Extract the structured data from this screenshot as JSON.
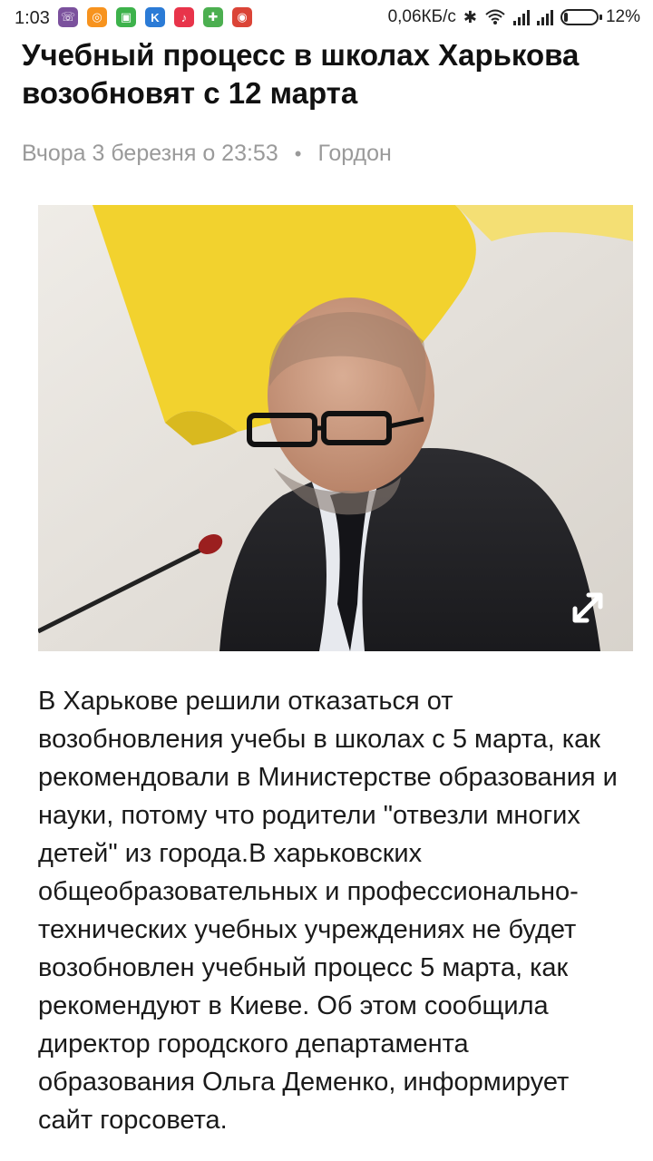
{
  "status_bar": {
    "time": "1:03",
    "net_speed": "0,06КБ/с",
    "battery_percent": "12%",
    "battery_level": 0.12,
    "notification_icons": [
      {
        "icon": "viber-icon",
        "color": "#7b519d",
        "glyph": "☏"
      },
      {
        "icon": "ok-app-icon",
        "color": "#f7931e",
        "glyph": "◎"
      },
      {
        "icon": "android-app-icon",
        "color": "#3db24b",
        "glyph": "▣"
      },
      {
        "icon": "k-app-icon",
        "color": "#2b7bd6",
        "glyph": "K"
      },
      {
        "icon": "music-app-icon",
        "color": "#e8344a",
        "glyph": "♪"
      },
      {
        "icon": "puzzle-app-icon",
        "color": "#4caf50",
        "glyph": "✚"
      },
      {
        "icon": "chrome-icon",
        "color": "#db4437",
        "glyph": "◉"
      }
    ]
  },
  "article": {
    "title": "Учебный процесс в школах Харькова возобновят с 12 марта",
    "date": "Вчора 3 березня о 23:53",
    "separator": "•",
    "source": "Гордон",
    "body": "В Харькове решили отказаться от возобновления учебы в школах с 5 марта, как рекомендовали в Министерстве образования и науки, потому что родители \"отвезли многих детей\" из города.В харьковских общеобразовательных и профессионально-технических учебных учреждениях не будет возобновлен учебный процесс 5 марта, как рекомендуют в Киеве. Об этом сообщила директор городского департамента образования Ольга Деменко, информирует сайт горсовета."
  },
  "colors": {
    "flag_yellow": "#f2d22e",
    "text_primary": "#111111",
    "text_meta": "#9a9a9a"
  }
}
